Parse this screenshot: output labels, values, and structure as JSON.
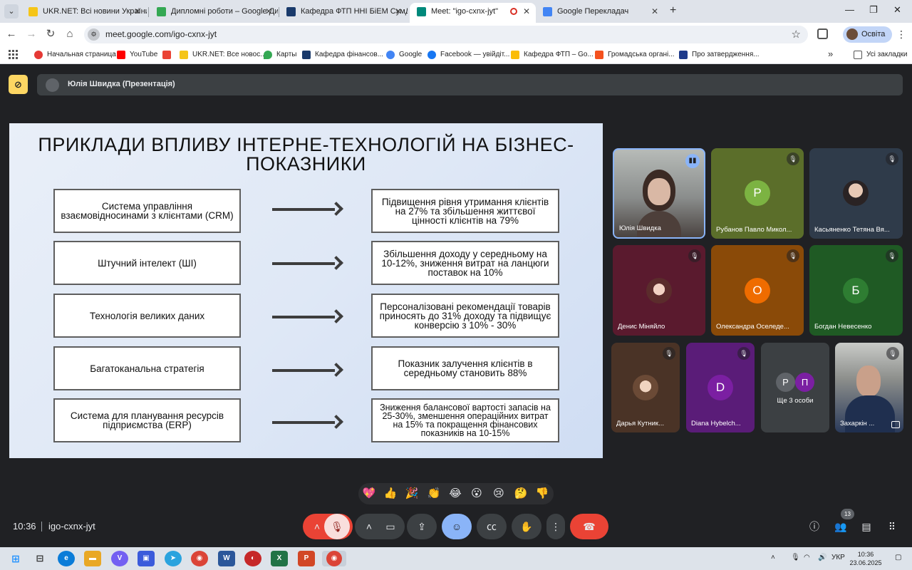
{
  "browser": {
    "tabs": [
      {
        "label": "UKR.NET: Всі новини України, ...",
        "fav": "#f5c518"
      },
      {
        "label": "Дипломні роботи – Google Диск",
        "fav": "#34a853"
      },
      {
        "label": "Кафедра ФТП ННІ БіЕМ СумДУ",
        "fav": "#1a3a6b"
      },
      {
        "label": "Meet: \"igo-cxnx-jyt\"",
        "fav": "#00897b"
      },
      {
        "label": "Google Перекладач",
        "fav": "#4285f4"
      }
    ],
    "url": "meet.google.com/igo-cxnx-jyt",
    "profile_label": "Освіта",
    "bookmarks": [
      {
        "label": "Начальная страница",
        "fav": "#e53935"
      },
      {
        "label": "YouTube",
        "fav": "#ff0000"
      },
      {
        "label": "",
        "fav": "#ea4335"
      },
      {
        "label": "UKR.NET: Все новос...",
        "fav": "#f5c518"
      },
      {
        "label": "Карты",
        "fav": "#34a853"
      },
      {
        "label": "Кафедра фінансов...",
        "fav": "#1a3a6b"
      },
      {
        "label": "Google",
        "fav": "#4285f4"
      },
      {
        "label": "Facebook — увійдіт...",
        "fav": "#1877f2"
      },
      {
        "label": "Кафедра ФТП – Go...",
        "fav": "#fbbc04"
      },
      {
        "label": "Громадська органі...",
        "fav": "#f4511e"
      },
      {
        "label": "Про затвердження...",
        "fav": "#1e3a8a"
      }
    ],
    "all_bookmarks": "Усі закладки"
  },
  "meet": {
    "presenter_title": "Юлія Швидка (Презентація)",
    "slide": {
      "title_line1": "ПРИКЛАДИ ВПЛИВУ ІНТЕРНЕ-ТЕХНОЛОГІЙ НА БІЗНЕС-",
      "title_line2": "ПОКАЗНИКИ",
      "rows": [
        {
          "left": "Система управління взаємовідносинами з клієнтами (CRM)",
          "right": "Підвищення рівня утримання клієнтів на 27% та збільшення життєвої цінності клієнтів на 79%"
        },
        {
          "left": "Штучний інтелект (ШІ)",
          "right": "Збільшення доходу у середньому на 10-12%, зниження витрат на ланцюги поставок на 10%"
        },
        {
          "left": "Технологія великих даних",
          "right": "Персоналізовані рекомендації товарів приносять до 31% доходу та підвищує конверсію з 10% - 30%"
        },
        {
          "left": "Багатоканальна стратегія",
          "right": "Показник залучення клієнтів в середньому становить 88%"
        },
        {
          "left": "Система для планування ресурсів підприємства (ERP)",
          "right": "Зниження балансової вартості запасів на 25-30%, зменшення операційних витрат на 15% та покращення фінансових показників на 10-15%"
        }
      ]
    },
    "participants": [
      {
        "name": "Юлія Швидка",
        "bg": "#8a8d8c",
        "kind": "video"
      },
      {
        "name": "Рубанов Павло Микол...",
        "bg": "#5b6e2a",
        "letter": "Р",
        "lc": "#7cb342"
      },
      {
        "name": "Касьяненко Тетяна Вя...",
        "bg": "#2f3b4a",
        "kind": "photo"
      },
      {
        "name": "Денис Міняйло",
        "bg": "#5a1a2e",
        "kind": "photo"
      },
      {
        "name": "Олександра Оселеде...",
        "bg": "#8a4a08",
        "letter": "О",
        "lc": "#ef6c00"
      },
      {
        "name": "Богдан Невесенко",
        "bg": "#1f5a24",
        "letter": "Б",
        "lc": "#2e7d32"
      },
      {
        "name": "Дарья Кутник...",
        "bg": "#4a3326",
        "kind": "photo"
      },
      {
        "name": "Diana Hybelch...",
        "bg": "#5a1c78",
        "letter": "D",
        "lc": "#7b1fa2"
      },
      {
        "name": "Ще 3 особи",
        "bg": "#3c4043"
      },
      {
        "name": "Захаркін ...",
        "bg": "#7a7c7a",
        "kind": "video"
      }
    ],
    "more_letters": [
      "Р",
      "П"
    ],
    "reactions": [
      "💖",
      "👍",
      "🎉",
      "👏",
      "😂",
      "😮",
      "😢",
      "🤔",
      "👎"
    ],
    "time": "10:36",
    "meeting_code": "igo-cxnx-jyt",
    "people_count": "13"
  },
  "taskbar": {
    "apps": [
      {
        "name": "start",
        "color": "#1e90ff",
        "glyph": "⊞"
      },
      {
        "name": "widgets",
        "color": "#444",
        "glyph": "⊟"
      },
      {
        "name": "edge",
        "color": "#0a7cd8",
        "glyph": "e"
      },
      {
        "name": "explorer",
        "color": "#e9a825",
        "glyph": "▬"
      },
      {
        "name": "viber",
        "color": "#7360f2",
        "glyph": "V"
      },
      {
        "name": "save",
        "color": "#3b5bdb",
        "glyph": "▣"
      },
      {
        "name": "telegram",
        "color": "#2aa3de",
        "glyph": "➤"
      },
      {
        "name": "chrome",
        "color": "#db4437",
        "glyph": "◉"
      },
      {
        "name": "word",
        "color": "#2b579a",
        "glyph": "W"
      },
      {
        "name": "app",
        "color": "#c62828",
        "glyph": "◐"
      },
      {
        "name": "excel",
        "color": "#217346",
        "glyph": "X"
      },
      {
        "name": "powerpoint",
        "color": "#d24726",
        "glyph": "P"
      },
      {
        "name": "chrome-active",
        "color": "#db4437",
        "glyph": "◉"
      }
    ],
    "lang": "УКР",
    "clock_time": "10:36",
    "clock_date": "23.06.2025"
  }
}
